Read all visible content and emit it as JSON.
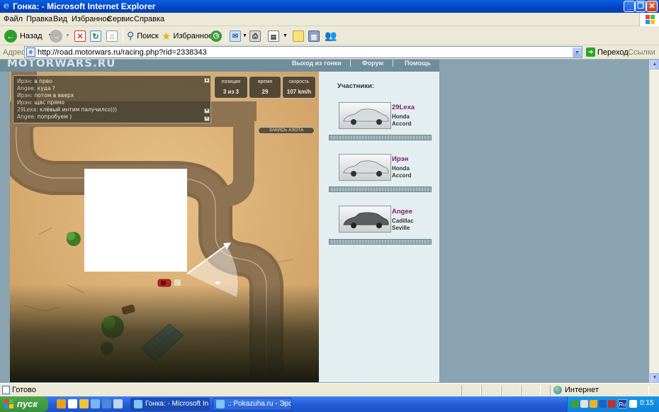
{
  "window": {
    "title": "Гонка: - Microsoft Internet Explorer"
  },
  "menu": [
    "Файл",
    "Правка",
    "Вид",
    "Избранное",
    "Сервис",
    "Справка"
  ],
  "toolbar": {
    "back_label": "Назад",
    "search_label": "Поиск",
    "favorites_label": "Избранное"
  },
  "address": {
    "label": "Адрес:",
    "url": "http://road.motorwars.ru/racing.php?rid=2338343",
    "go_label": "Переход",
    "links_label": "Ссылки"
  },
  "site": {
    "logo": "MOTORWARS.RU",
    "nav": [
      "Выход из гонки",
      "Форум",
      "Помощь"
    ]
  },
  "game": {
    "chat": [
      {
        "user": "Ирэн:",
        "text": "в прво"
      },
      {
        "user": "Angee:",
        "text": "куда ?"
      },
      {
        "user": "Ирэн:",
        "text": "потом в вверх"
      },
      {
        "user": "Ирэн:",
        "text": "щас прямо"
      },
      {
        "user": "29Lexa:",
        "text": "клёвый интим палучилсо)))"
      },
      {
        "user": "Angee:",
        "text": "попробуем )"
      }
    ],
    "hud": [
      {
        "label": "позиция",
        "value": "3 из 3"
      },
      {
        "label": "время",
        "value": "29"
      },
      {
        "label": "скорость",
        "value": "107 km/h"
      }
    ],
    "nitro_label": "ЗАКИСЬ АЗОТА"
  },
  "participants": {
    "title": "Участники:",
    "list": [
      {
        "name": "29Lexa",
        "car_line1": "Honda",
        "car_line2": "Accord",
        "car_color": "#d8dcde"
      },
      {
        "name": "Ирэн",
        "car_line1": "Honda",
        "car_line2": "Accord",
        "car_color": "#d8dcde"
      },
      {
        "name": "Angee",
        "car_line1": "Cadillac",
        "car_line2": "Seville",
        "car_color": "#5a5e60"
      }
    ]
  },
  "status": {
    "text": "Готово",
    "zone": "Интернет"
  },
  "taskbar": {
    "start_label": "пуск",
    "tasks": [
      "Гонка: - Microsoft In...",
      ".: Pokazuha.ru - Эро..."
    ],
    "lang": "Ru",
    "clock": "0:15"
  },
  "colors": {
    "title_bar": "#0a5fe0",
    "start_button": "#3a8f38",
    "participant_name": "#7a1f6d"
  }
}
